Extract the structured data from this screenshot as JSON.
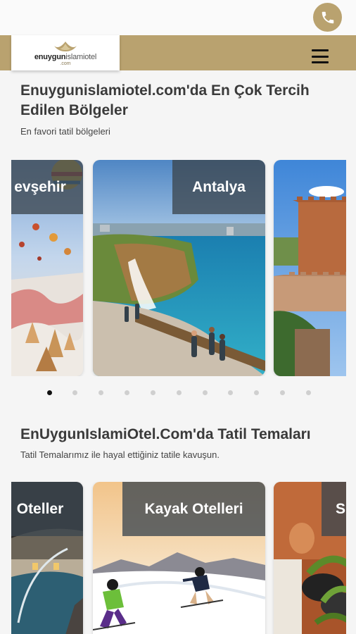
{
  "header": {
    "logo_brand_bold": "enuygun",
    "logo_brand_light": "islamiotel",
    "logo_sub": ".com",
    "phone_icon": "phone-icon",
    "menu_icon": "hamburger-menu-icon"
  },
  "regions": {
    "title": "Enuygunislamiotel.com'da En Çok Tercih Edilen Bölgeler",
    "subtitle": "En favori tatil bölgeleri",
    "cards": [
      {
        "label": "evşehir"
      },
      {
        "label": "Antalya"
      },
      {
        "label": ""
      }
    ],
    "dot_count": 11,
    "active_dot": 0
  },
  "themes": {
    "title": "EnUygunIslamiOtel.Com'da Tatil Temaları",
    "subtitle": "Tatil Temalarımız ile hayal ettiğiniz tatile kavuşun.",
    "cards": [
      {
        "label": "Oteller"
      },
      {
        "label": "Kayak Otelleri"
      },
      {
        "label": "S"
      }
    ]
  },
  "colors": {
    "brand_gold": "#b9a26f",
    "label_overlay": "#3c4650"
  }
}
